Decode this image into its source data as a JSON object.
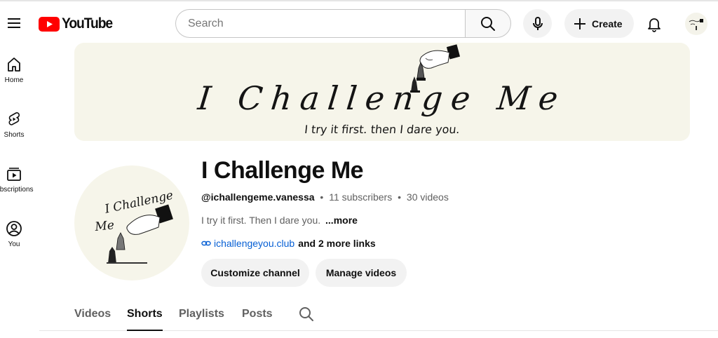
{
  "header": {
    "logo_text": "YouTube",
    "search_placeholder": "Search",
    "create_label": "Create",
    "brand_color": "#ff0000"
  },
  "sidebar": {
    "items": [
      {
        "label": "Home",
        "icon": "home-icon"
      },
      {
        "label": "Shorts",
        "icon": "shorts-icon"
      },
      {
        "label": "Subscriptions",
        "icon": "subscriptions-icon"
      },
      {
        "label": "You",
        "icon": "you-icon"
      }
    ]
  },
  "banner": {
    "title": "I Challenge Me",
    "tagline": "I try it first. then I dare you."
  },
  "avatar": {
    "line1": "I Challenge",
    "line2": "Me"
  },
  "channel": {
    "name": "I Challenge Me",
    "handle": "@ichallengeme.vanessa",
    "subscribers": "11 subscribers",
    "videos": "30 videos",
    "separator": "•",
    "description": "I try it first. Then I dare you.",
    "more_label": "...more",
    "link_text": "ichallengeyou.club",
    "more_links": "and 2 more links",
    "customize_label": "Customize channel",
    "manage_label": "Manage videos"
  },
  "tabs": [
    {
      "label": "Videos",
      "active": false
    },
    {
      "label": "Shorts",
      "active": true
    },
    {
      "label": "Playlists",
      "active": false
    },
    {
      "label": "Posts",
      "active": false
    }
  ]
}
